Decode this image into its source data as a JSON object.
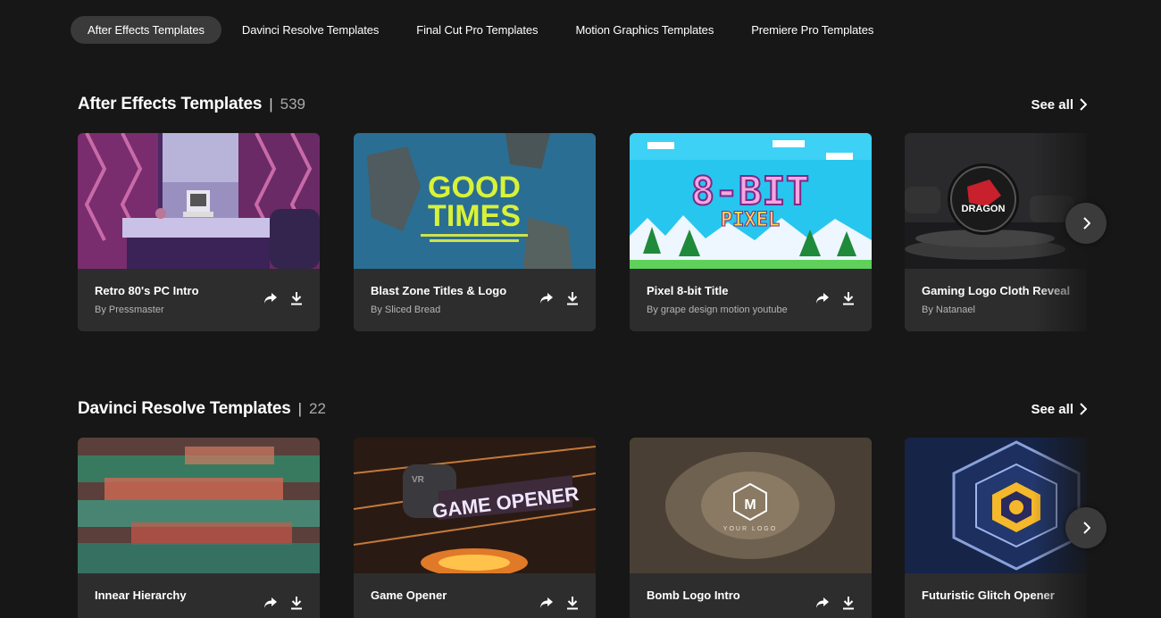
{
  "categories": [
    {
      "label": "After Effects Templates",
      "active": true
    },
    {
      "label": "Davinci Resolve Templates",
      "active": false
    },
    {
      "label": "Final Cut Pro Templates",
      "active": false
    },
    {
      "label": "Motion Graphics Templates",
      "active": false
    },
    {
      "label": "Premiere Pro Templates",
      "active": false
    }
  ],
  "sections": [
    {
      "title": "After Effects Templates",
      "separator": "|",
      "count": "539",
      "see_all": "See all",
      "cards": [
        {
          "title": "Retro 80's PC Intro",
          "author": "By Pressmaster",
          "thumb_text": ""
        },
        {
          "title": "Blast Zone Titles & Logo",
          "author": "By Sliced Bread",
          "thumb_text": "GOOD TIMES"
        },
        {
          "title": "Pixel 8-bit Title",
          "author": "By grape design motion youtube",
          "thumb_text": "8-BIT PIXEL"
        },
        {
          "title": "Gaming Logo Cloth Reveal",
          "author": "By Natanael",
          "thumb_text": "DRAGON"
        }
      ]
    },
    {
      "title": "Davinci Resolve Templates",
      "separator": "|",
      "count": "22",
      "see_all": "See all",
      "cards": [
        {
          "title": "Innear Hierarchy",
          "author": "",
          "thumb_text": ""
        },
        {
          "title": "Game Opener",
          "author": "",
          "thumb_text": "GAME OPENER"
        },
        {
          "title": "Bomb Logo Intro",
          "author": "",
          "thumb_text": "YOUR LOGO"
        },
        {
          "title": "Futuristic Glitch Opener",
          "author": "",
          "thumb_text": ""
        }
      ]
    }
  ],
  "icons": {
    "share": "share-icon",
    "download": "download-icon",
    "see_all": "chevron-right-icon",
    "next": "chevron-right-icon"
  },
  "colors": {
    "background": "#171717",
    "card": "#2d2d2d",
    "pill_active": "#3a3a3a",
    "next_button": "#3b3b3b"
  }
}
